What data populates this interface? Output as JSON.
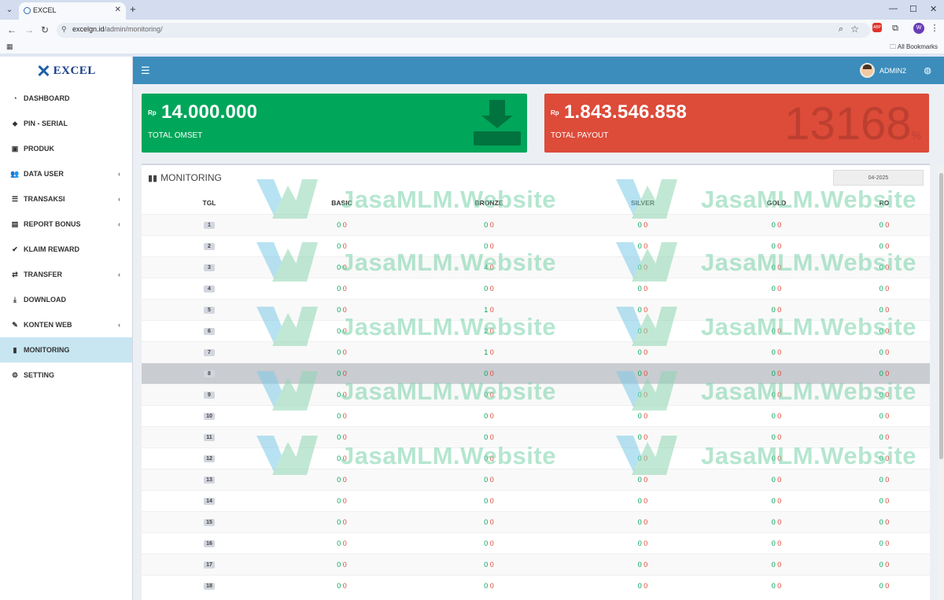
{
  "browser": {
    "tab_title": "EXCEL",
    "url_domain": "excelgn.id",
    "url_path": "/admin/monitoring/",
    "bookmarks_label": "All Bookmarks",
    "ext_profile": "W"
  },
  "app": {
    "logo_text": "EXCEL",
    "user_name": "ADMIN2"
  },
  "sidebar": {
    "items": [
      {
        "label": "DASHBOARD",
        "icon": "dashboard-icon",
        "glyph": "◔",
        "caret": false,
        "active": false
      },
      {
        "label": "PIN - SERIAL",
        "icon": "tags-icon",
        "glyph": "⬥",
        "caret": false,
        "active": false
      },
      {
        "label": "PRODUK",
        "icon": "cube-icon",
        "glyph": "▣",
        "caret": false,
        "active": false
      },
      {
        "label": "DATA USER",
        "icon": "users-icon",
        "glyph": "👥",
        "caret": true,
        "active": false
      },
      {
        "label": "TRANSAKSI",
        "icon": "list-icon",
        "glyph": "☰",
        "caret": true,
        "active": false
      },
      {
        "label": "REPORT BONUS",
        "icon": "money-icon",
        "glyph": "▤",
        "caret": true,
        "active": false
      },
      {
        "label": "KLAIM REWARD",
        "icon": "check-icon",
        "glyph": "✔",
        "caret": false,
        "active": false
      },
      {
        "label": "TRANSFER",
        "icon": "exchange-icon",
        "glyph": "⇄",
        "caret": true,
        "active": false
      },
      {
        "label": "DOWNLOAD",
        "icon": "download-icon",
        "glyph": "⤓",
        "caret": false,
        "active": false
      },
      {
        "label": "KONTEN WEB",
        "icon": "edit-icon",
        "glyph": "✎",
        "caret": true,
        "active": false
      },
      {
        "label": "MONITORING",
        "icon": "bar-chart-icon",
        "glyph": "▮",
        "caret": false,
        "active": true
      },
      {
        "label": "SETTING",
        "icon": "cogs-icon",
        "glyph": "⚙",
        "caret": false,
        "active": false
      }
    ]
  },
  "stats": {
    "omset": {
      "currency": "Rp",
      "value": "14.000.000",
      "label": "TOTAL OMSET"
    },
    "payout": {
      "currency": "Rp",
      "value": "1.843.546.858",
      "label": "TOTAL PAYOUT",
      "big": "13168",
      "big_suffix": "%"
    }
  },
  "monitoring": {
    "title": "MONITORING",
    "month": "04-2025",
    "columns": [
      "TGL",
      "BASIC",
      "BRONZE",
      "SILVER",
      "GOLD",
      "RO"
    ],
    "highlight_row": 8,
    "rows": [
      {
        "tgl": "1",
        "basic": [
          "0",
          "0"
        ],
        "bronze": [
          "0",
          "0"
        ],
        "silver": [
          "0",
          "0"
        ],
        "gold": [
          "0",
          "0"
        ],
        "ro": [
          "0",
          "0"
        ]
      },
      {
        "tgl": "2",
        "basic": [
          "0",
          "0"
        ],
        "bronze": [
          "0",
          "0"
        ],
        "silver": [
          "0",
          "0"
        ],
        "gold": [
          "0",
          "0"
        ],
        "ro": [
          "0",
          "0"
        ]
      },
      {
        "tgl": "3",
        "basic": [
          "0",
          "0"
        ],
        "bronze": [
          "4",
          "0"
        ],
        "silver": [
          "0",
          "0"
        ],
        "gold": [
          "0",
          "0"
        ],
        "ro": [
          "0",
          "0"
        ]
      },
      {
        "tgl": "4",
        "basic": [
          "0",
          "0"
        ],
        "bronze": [
          "0",
          "0"
        ],
        "silver": [
          "0",
          "0"
        ],
        "gold": [
          "0",
          "0"
        ],
        "ro": [
          "0",
          "0"
        ]
      },
      {
        "tgl": "5",
        "basic": [
          "0",
          "0"
        ],
        "bronze": [
          "1",
          "0"
        ],
        "silver": [
          "0",
          "0"
        ],
        "gold": [
          "0",
          "0"
        ],
        "ro": [
          "0",
          "0"
        ]
      },
      {
        "tgl": "6",
        "basic": [
          "0",
          "0"
        ],
        "bronze": [
          "2",
          "0"
        ],
        "silver": [
          "0",
          "0"
        ],
        "gold": [
          "0",
          "0"
        ],
        "ro": [
          "0",
          "0"
        ]
      },
      {
        "tgl": "7",
        "basic": [
          "0",
          "0"
        ],
        "bronze": [
          "1",
          "0"
        ],
        "silver": [
          "0",
          "0"
        ],
        "gold": [
          "0",
          "0"
        ],
        "ro": [
          "0",
          "0"
        ]
      },
      {
        "tgl": "8",
        "basic": [
          "0",
          "0"
        ],
        "bronze": [
          "0",
          "0"
        ],
        "silver": [
          "0",
          "0"
        ],
        "gold": [
          "0",
          "0"
        ],
        "ro": [
          "0",
          "0"
        ]
      },
      {
        "tgl": "9",
        "basic": [
          "0",
          "0"
        ],
        "bronze": [
          "0",
          "0"
        ],
        "silver": [
          "0",
          "0"
        ],
        "gold": [
          "0",
          "0"
        ],
        "ro": [
          "0",
          "0"
        ]
      },
      {
        "tgl": "10",
        "basic": [
          "0",
          "0"
        ],
        "bronze": [
          "0",
          "0"
        ],
        "silver": [
          "0",
          "0"
        ],
        "gold": [
          "0",
          "0"
        ],
        "ro": [
          "0",
          "0"
        ]
      },
      {
        "tgl": "11",
        "basic": [
          "0",
          "0"
        ],
        "bronze": [
          "0",
          "0"
        ],
        "silver": [
          "0",
          "0"
        ],
        "gold": [
          "0",
          "0"
        ],
        "ro": [
          "0",
          "0"
        ]
      },
      {
        "tgl": "12",
        "basic": [
          "0",
          "0"
        ],
        "bronze": [
          "0",
          "0"
        ],
        "silver": [
          "0",
          "0"
        ],
        "gold": [
          "0",
          "0"
        ],
        "ro": [
          "0",
          "0"
        ]
      },
      {
        "tgl": "13",
        "basic": [
          "0",
          "0"
        ],
        "bronze": [
          "0",
          "0"
        ],
        "silver": [
          "0",
          "0"
        ],
        "gold": [
          "0",
          "0"
        ],
        "ro": [
          "0",
          "0"
        ]
      },
      {
        "tgl": "14",
        "basic": [
          "0",
          "0"
        ],
        "bronze": [
          "0",
          "0"
        ],
        "silver": [
          "0",
          "0"
        ],
        "gold": [
          "0",
          "0"
        ],
        "ro": [
          "0",
          "0"
        ]
      },
      {
        "tgl": "15",
        "basic": [
          "0",
          "0"
        ],
        "bronze": [
          "0",
          "0"
        ],
        "silver": [
          "0",
          "0"
        ],
        "gold": [
          "0",
          "0"
        ],
        "ro": [
          "0",
          "0"
        ]
      },
      {
        "tgl": "16",
        "basic": [
          "0",
          "0"
        ],
        "bronze": [
          "0",
          "0"
        ],
        "silver": [
          "0",
          "0"
        ],
        "gold": [
          "0",
          "0"
        ],
        "ro": [
          "0",
          "0"
        ]
      },
      {
        "tgl": "17",
        "basic": [
          "0",
          "0"
        ],
        "bronze": [
          "0",
          "0"
        ],
        "silver": [
          "0",
          "0"
        ],
        "gold": [
          "0",
          "0"
        ],
        "ro": [
          "0",
          "0"
        ]
      },
      {
        "tgl": "18",
        "basic": [
          "0",
          "0"
        ],
        "bronze": [
          "0",
          "0"
        ],
        "silver": [
          "0",
          "0"
        ],
        "gold": [
          "0",
          "0"
        ],
        "ro": [
          "0",
          "0"
        ]
      }
    ]
  },
  "watermark": {
    "text": "JasaMLM.Website"
  },
  "colors": {
    "topbar": "#3c8dbc",
    "green": "#00a65a",
    "red": "#dd4b39",
    "active": "#c7e6f1"
  }
}
